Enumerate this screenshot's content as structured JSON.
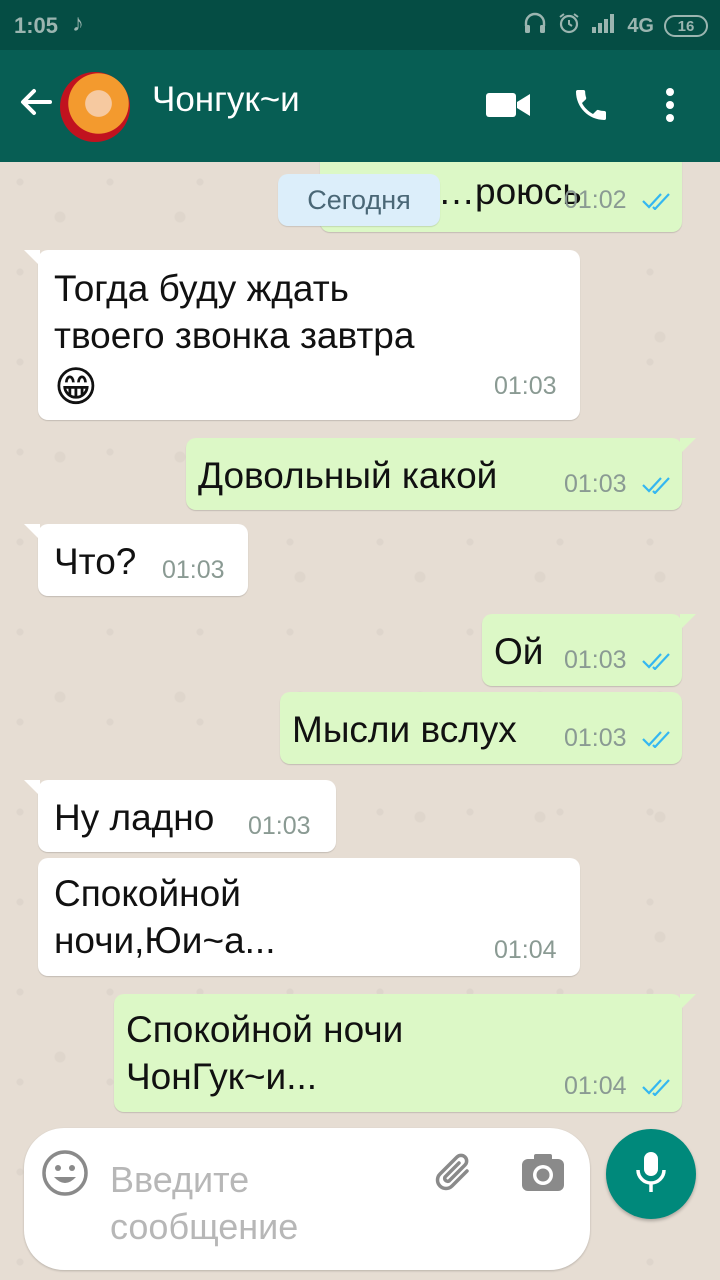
{
  "status_bar": {
    "time": "1:05",
    "network": "4G",
    "battery": "16",
    "icons": [
      "tiktok-icon",
      "headphones-icon",
      "alarm-icon",
      "signal-icon",
      "battery-icon"
    ]
  },
  "header": {
    "title": "Чонгук~и",
    "icons": [
      "back-arrow-icon",
      "video-call-icon",
      "phone-icon",
      "more-vert-icon"
    ]
  },
  "date_chip": "Сегодня",
  "messages": [
    {
      "dir": "out",
      "text": "…роюсь",
      "time": "01:02",
      "read": true
    },
    {
      "dir": "in",
      "text": "Тогда буду ждать\nтвоего звонка завтра",
      "emoji": "😁",
      "time": "01:03"
    },
    {
      "dir": "out",
      "text": "Довольный какой",
      "time": "01:03",
      "read": true
    },
    {
      "dir": "in",
      "text": "Что?",
      "time": "01:03"
    },
    {
      "dir": "out",
      "text": "Ой",
      "time": "01:03",
      "read": true
    },
    {
      "dir": "out",
      "text": "Мысли вслух",
      "time": "01:03",
      "read": true
    },
    {
      "dir": "in",
      "text": "Ну ладно",
      "time": "01:03"
    },
    {
      "dir": "in",
      "text": "Спокойной\nночи,Юи~а...",
      "time": "01:04"
    },
    {
      "dir": "out",
      "text": "Спокойной ночи\nЧонГук~и...",
      "time": "01:04",
      "read": true
    }
  ],
  "input": {
    "placeholder": "Введите\nсообщение",
    "icons": [
      "emoji-icon",
      "attach-icon",
      "camera-icon",
      "mic-icon"
    ]
  },
  "colors": {
    "header": "#075e54",
    "status_bar": "#054d44",
    "outgoing": "#dcf8c6",
    "incoming": "#ffffff",
    "ticks": "#34b7f1",
    "fab": "#00897b"
  }
}
